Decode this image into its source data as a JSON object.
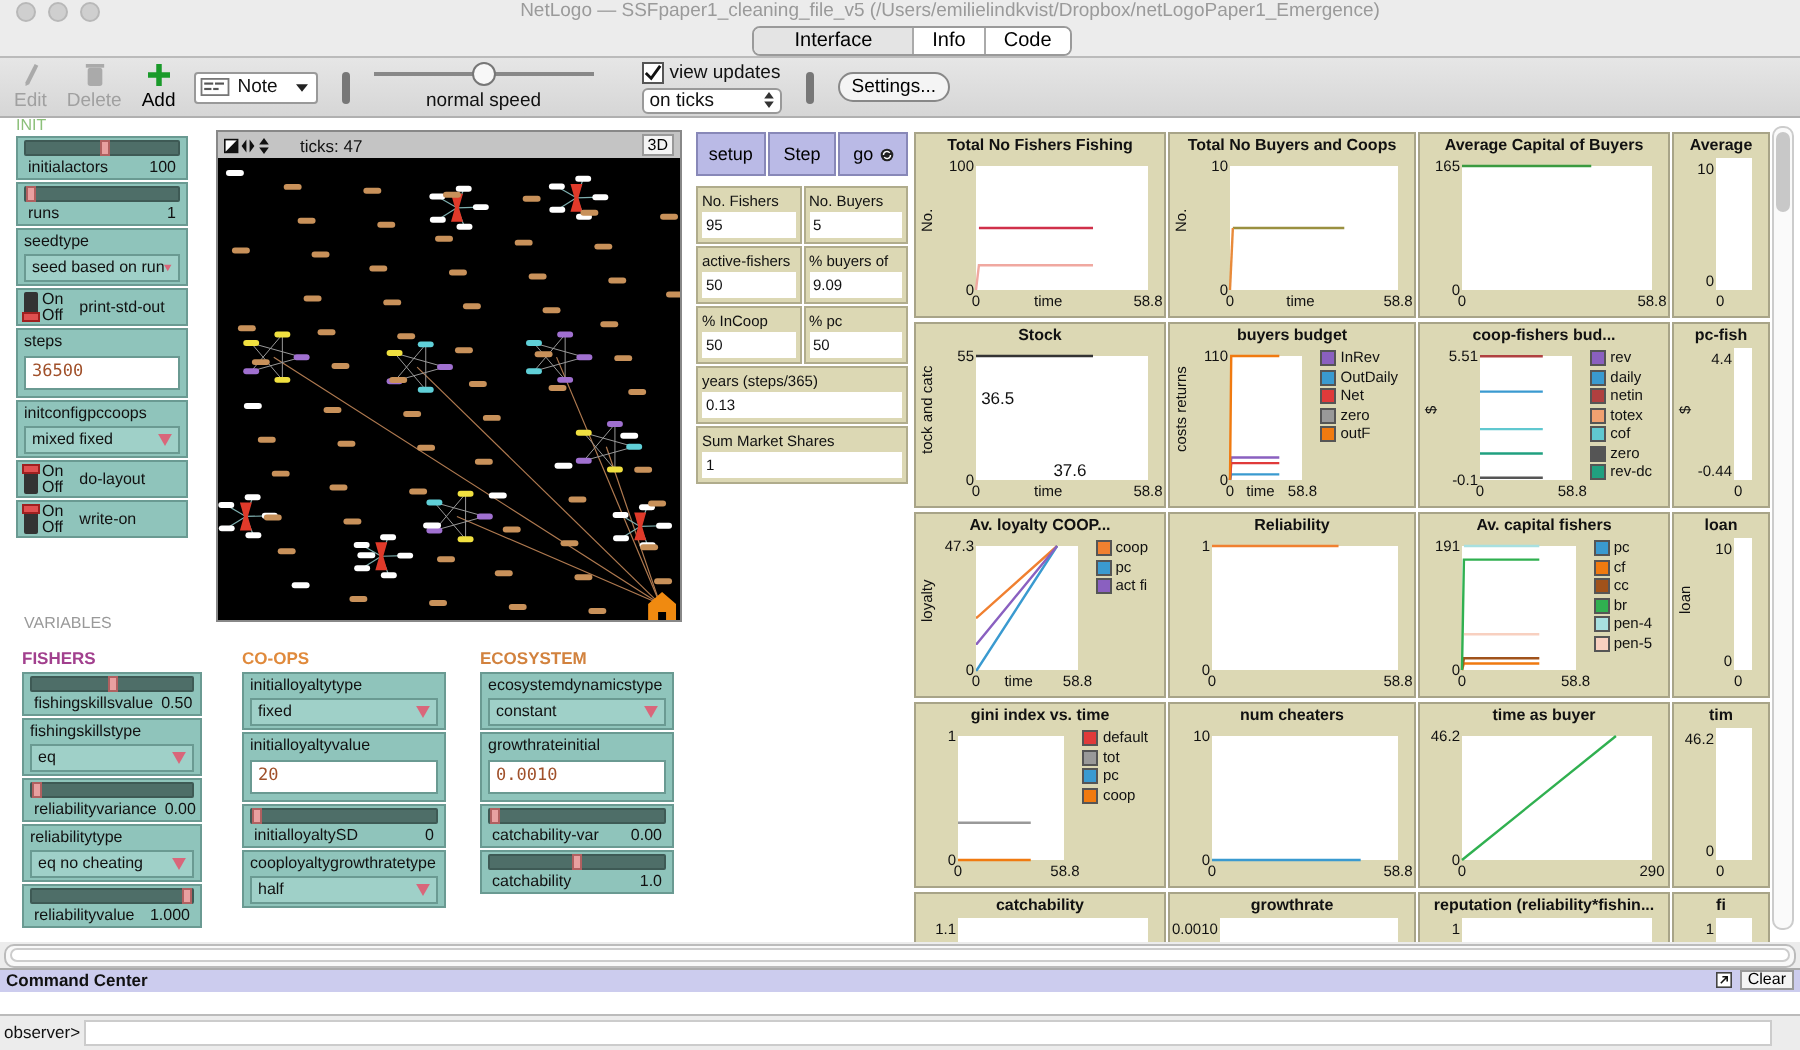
{
  "window": {
    "title": "NetLogo — SSFpaper1_cleaning_file_v5 (/Users/emilielindkvist/Dropbox/netLogoPaper1_Emergence)"
  },
  "tabs": [
    {
      "label": "Interface",
      "selected": true
    },
    {
      "label": "Info",
      "selected": false
    },
    {
      "label": "Code",
      "selected": false
    }
  ],
  "toolbar": {
    "tools": [
      {
        "label": "Edit",
        "kind": "edit",
        "disabled": true
      },
      {
        "label": "Delete",
        "kind": "delete",
        "disabled": true
      },
      {
        "label": "Add",
        "kind": "add",
        "disabled": false
      }
    ],
    "widget_type": "Note",
    "speed": {
      "level": 0.5,
      "label": "normal speed"
    },
    "view_updates": {
      "label": "view updates",
      "checked": true
    },
    "update_mode": "on ticks",
    "settings": "Settings..."
  },
  "init": {
    "label": "INIT",
    "widgets": [
      {
        "kind": "slider",
        "name": "initialactors",
        "value": "100",
        "level": 0.52
      },
      {
        "kind": "slider",
        "name": "runs",
        "value": "1",
        "level": 0
      },
      {
        "kind": "chooser",
        "name": "seedtype",
        "value": "seed based on run"
      },
      {
        "kind": "switch",
        "name": "print-std-out",
        "on": false,
        "on_label": "On",
        "off_label": "Off"
      },
      {
        "kind": "input",
        "name": "steps",
        "value": "36500"
      },
      {
        "kind": "chooser",
        "name": "initconfigpccoops",
        "value": "mixed fixed"
      },
      {
        "kind": "switch",
        "name": "do-layout",
        "on": true,
        "on_label": "On",
        "off_label": "Off"
      },
      {
        "kind": "switch",
        "name": "write-on",
        "on": true,
        "on_label": "On",
        "off_label": "Off"
      }
    ]
  },
  "view": {
    "ticks": "ticks: 47",
    "button_3d": "3D"
  },
  "buttons": [
    {
      "label": "setup",
      "forever": false
    },
    {
      "label": "Step",
      "forever": false
    },
    {
      "label": "go",
      "forever": true
    }
  ],
  "monitors": [
    {
      "name": "No. Fishers",
      "value": "95",
      "kind": "half"
    },
    {
      "name": "No. Buyers",
      "value": "5",
      "kind": "half"
    },
    {
      "name": "active-fishers",
      "value": "50",
      "kind": "half"
    },
    {
      "name": "% buyers of",
      "value": "9.09",
      "kind": "half"
    },
    {
      "name": "% InCoop",
      "value": "50",
      "kind": "half"
    },
    {
      "name": "% pc",
      "value": "50",
      "kind": "half"
    },
    {
      "name": "years (steps/365)",
      "value": "0.13",
      "kind": "full"
    },
    {
      "name": "Sum Market Shares",
      "value": "1",
      "kind": "full"
    }
  ],
  "variables": {
    "label": "VARIABLES",
    "sections": [
      {
        "title": "FISHERS",
        "color": "#a2408e",
        "widgets": [
          {
            "kind": "slider",
            "name": "fishingskillsvalue",
            "value": "0.50",
            "level": 0.5
          },
          {
            "kind": "chooser",
            "name": "fishingskillstype",
            "value": "eq"
          },
          {
            "kind": "slider",
            "name": "reliabilityvariance",
            "value": "0.00",
            "level": 0
          },
          {
            "kind": "chooser",
            "name": "reliabilitytype",
            "value": "eq no cheating"
          },
          {
            "kind": "slider",
            "name": "reliabilityvalue",
            "value": "1.000",
            "level": 1
          }
        ]
      },
      {
        "title": "CO-OPS",
        "color": "#e08a3c",
        "widgets": [
          {
            "kind": "chooser",
            "name": "initialloyaltytype",
            "value": "fixed"
          },
          {
            "kind": "input",
            "name": "initialloyaltyvalue",
            "value": "20"
          },
          {
            "kind": "slider",
            "name": "initialloyaltySD",
            "value": "0",
            "level": 0
          },
          {
            "kind": "chooser",
            "name": "cooployaltygrowthratetype",
            "value": "half"
          }
        ]
      },
      {
        "title": "ECOSYSTEM",
        "color": "#d2823e",
        "widgets": [
          {
            "kind": "chooser",
            "name": "ecosystemdynamicstype",
            "value": "constant"
          },
          {
            "kind": "input",
            "name": "growthrateinitial",
            "value": "0.0010"
          },
          {
            "kind": "slider",
            "name": "catchability-var",
            "value": "0.00",
            "level": 0
          },
          {
            "kind": "slider",
            "name": "catchability",
            "value": "1.0",
            "level": 0.5
          }
        ]
      }
    ]
  },
  "plots": [
    {
      "kind": "chart",
      "chart_data": {
        "type": "line",
        "title": "Total No Fishers Fishing",
        "xlabel": "time",
        "ylabel": "No.",
        "x": [
          0,
          1,
          40
        ],
        "xlim": [
          0,
          58.8
        ],
        "ylim": [
          0,
          100
        ],
        "xticks": [
          0,
          58.8
        ],
        "yticks": [
          0,
          100
        ],
        "series": [
          {
            "color": "#d0304a",
            "values": [
              null,
              50,
              50
            ]
          },
          {
            "color": "#f0a8a0",
            "values": [
              0,
              20,
              20
            ]
          }
        ]
      }
    },
    {
      "kind": "chart",
      "chart_data": {
        "type": "line",
        "title": "Total No Buyers and Coops",
        "xlabel": "time",
        "ylabel": "No.",
        "x": [
          0,
          1,
          40
        ],
        "xlim": [
          0,
          58.8
        ],
        "ylim": [
          0,
          10
        ],
        "xticks": [
          0,
          58.8
        ],
        "yticks": [
          0,
          10
        ],
        "series": [
          {
            "color": "#9a9040",
            "values": [
              null,
              5,
              5
            ]
          },
          {
            "color": "#e88a3a",
            "values": [
              0,
              5,
              null
            ]
          }
        ]
      }
    },
    {
      "kind": "chart",
      "chart_data": {
        "type": "line",
        "title": "Average Capital of Buyers",
        "x": [
          0,
          40
        ],
        "xlim": [
          0,
          58.8
        ],
        "ylim": [
          0,
          165
        ],
        "xticks": [
          0,
          58.8
        ],
        "yticks": [
          0,
          165
        ],
        "series": [
          {
            "color": "#3a9a40",
            "values": [
              165,
              165
            ]
          }
        ]
      }
    },
    {
      "kind": "partial",
      "title": "Average",
      "y_labels": [
        "10",
        "0"
      ],
      "x_labels": [
        "0"
      ]
    },
    {
      "kind": "chart",
      "chart_data": {
        "type": "line",
        "title": "Stock",
        "xlabel": "time",
        "ylabel": "tock and catc",
        "x": [
          0,
          40
        ],
        "xlim": [
          0,
          58.8
        ],
        "ylim": [
          0,
          55
        ],
        "xticks": [
          0,
          58.8
        ],
        "yticks": [
          0,
          55
        ],
        "series": [
          {
            "color": "#333333",
            "values": [
              55,
              55
            ]
          }
        ],
        "annotations": [
          {
            "text": "36.5"
          },
          {
            "text": "37.6"
          }
        ]
      }
    },
    {
      "kind": "chart",
      "chart_data": {
        "type": "line",
        "title": "buyers budget",
        "xlabel": "time",
        "ylabel": "costs returns",
        "legend": "right",
        "x": [
          0,
          1,
          40
        ],
        "xlim": [
          0,
          58.8
        ],
        "ylim": [
          0,
          110
        ],
        "xticks": [
          0,
          58.8
        ],
        "yticks": [
          0,
          110
        ],
        "series": [
          {
            "name": "InRev",
            "color": "#8a60c0",
            "values": [
              0,
              20,
              20
            ]
          },
          {
            "name": "OutDaily",
            "color": "#3a9ad0",
            "values": [
              0,
              5,
              5
            ]
          },
          {
            "name": "Net",
            "color": "#e03a3a",
            "values": [
              0,
              15,
              15
            ]
          },
          {
            "name": "zero",
            "color": "#999999",
            "values": [
              null,
              null,
              null
            ]
          },
          {
            "name": "outF",
            "color": "#f07a10",
            "values": [
              0,
              110,
              110
            ]
          }
        ]
      }
    },
    {
      "kind": "chart",
      "chart_data": {
        "type": "line",
        "title": "coop-fishers bud...",
        "ylabel": "$",
        "legend": "right",
        "x": [
          0,
          40
        ],
        "xlim": [
          0,
          58.8
        ],
        "ylim": [
          -0.1,
          5.51
        ],
        "xticks": [
          0,
          58.8
        ],
        "yticks": [
          -0.1,
          5.51
        ],
        "series": [
          {
            "name": "rev",
            "color": "#8a60c0",
            "values": [
              null,
              null
            ]
          },
          {
            "name": "daily",
            "color": "#3a9ad0",
            "values": [
              3.9,
              3.9
            ]
          },
          {
            "name": "netin",
            "color": "#b04040",
            "values": [
              5.5,
              5.5
            ]
          },
          {
            "name": "totex",
            "color": "#f0a070",
            "values": [
              null,
              null
            ]
          },
          {
            "name": "cof",
            "color": "#60c8d0",
            "values": [
              2.2,
              2.2
            ]
          },
          {
            "name": "zero",
            "color": "#555555",
            "values": [
              0,
              0
            ]
          },
          {
            "name": "rev-dc",
            "color": "#20a080",
            "values": [
              1.1,
              1.1
            ]
          }
        ]
      }
    },
    {
      "kind": "partial",
      "title": "pc-fish",
      "ylabel": "$",
      "y_labels": [
        "4.4",
        "-0.44"
      ],
      "x_labels": [
        "0"
      ]
    },
    {
      "kind": "chart",
      "chart_data": {
        "type": "line",
        "title": "Av. loyalty COOP...",
        "xlabel": "time",
        "ylabel": "loyalty",
        "legend": "right",
        "x": [
          0,
          0.5,
          47
        ],
        "xlim": [
          0,
          58.8
        ],
        "ylim": [
          0,
          47.3
        ],
        "xticks": [
          0,
          58.8
        ],
        "yticks": [
          0,
          47.3
        ],
        "series": [
          {
            "name": "coop",
            "color": "#f08030",
            "values": [
              20,
              20,
              47.3
            ]
          },
          {
            "name": "pc",
            "color": "#3a9ad0",
            "values": [
              0,
              0,
              47.3
            ]
          },
          {
            "name": "act fi",
            "color": "#8a60c0",
            "values": [
              10,
              10,
              47.3
            ]
          }
        ]
      }
    },
    {
      "kind": "chart",
      "chart_data": {
        "type": "line",
        "title": "Reliability",
        "x": [
          0,
          40
        ],
        "xlim": [
          0,
          58.8
        ],
        "ylim": [
          0,
          1
        ],
        "xticks": [
          0,
          58.8
        ],
        "yticks": [
          0,
          1
        ],
        "series": [
          {
            "color": "#f08030",
            "values": [
              1,
              1
            ]
          }
        ]
      }
    },
    {
      "kind": "chart",
      "chart_data": {
        "type": "line",
        "title": "Av. capital fishers",
        "legend": "right",
        "x": [
          0,
          1,
          40
        ],
        "xlim": [
          0,
          58.8
        ],
        "ylim": [
          0,
          191
        ],
        "xticks": [
          0,
          58.8
        ],
        "yticks": [
          0,
          191
        ],
        "series": [
          {
            "name": "pc",
            "color": "#3a9ad0",
            "values": [
              null,
              null,
              null
            ]
          },
          {
            "name": "cf",
            "color": "#f07a10",
            "values": [
              0,
              10,
              10
            ]
          },
          {
            "name": "cc",
            "color": "#a0521a",
            "values": [
              0,
              18,
              18
            ]
          },
          {
            "name": "br",
            "color": "#30b050",
            "values": [
              0,
              170,
              170
            ]
          },
          {
            "name": "pen-4",
            "color": "#a8e0e0",
            "values": [
              null,
              191,
              191
            ]
          },
          {
            "name": "pen-5",
            "color": "#f8d0c0",
            "values": [
              null,
              55,
              55
            ]
          }
        ]
      }
    },
    {
      "kind": "partial",
      "title": "loan",
      "ylabel": "loan",
      "y_labels": [
        "10",
        "0"
      ],
      "x_labels": [
        "0"
      ]
    },
    {
      "kind": "chart",
      "chart_data": {
        "type": "line",
        "title": "gini index vs. time",
        "legend": "right",
        "x": [
          0,
          40
        ],
        "xlim": [
          0,
          58.8
        ],
        "ylim": [
          0,
          1
        ],
        "xticks": [
          0,
          58.8
        ],
        "yticks": [
          0,
          1
        ],
        "series": [
          {
            "name": "default",
            "color": "#e03a3a",
            "values": [
              null,
              null
            ]
          },
          {
            "name": "tot",
            "color": "#999999",
            "values": [
              0.3,
              0.3
            ]
          },
          {
            "name": "pc",
            "color": "#3a9ad0",
            "values": [
              null,
              null
            ]
          },
          {
            "name": "coop",
            "color": "#f07a10",
            "values": [
              0,
              0
            ]
          }
        ]
      }
    },
    {
      "kind": "chart",
      "chart_data": {
        "type": "line",
        "title": "num cheaters",
        "x": [
          0,
          47
        ],
        "xlim": [
          0,
          58.8
        ],
        "ylim": [
          0,
          10
        ],
        "xticks": [
          0,
          58.8
        ],
        "yticks": [
          0,
          10
        ],
        "series": [
          {
            "color": "#3a9ad0",
            "values": [
              0,
              0
            ]
          }
        ]
      }
    },
    {
      "kind": "chart",
      "chart_data": {
        "type": "line",
        "title": "time as buyer",
        "x": [
          0,
          235
        ],
        "xlim": [
          0,
          290
        ],
        "ylim": [
          0,
          46.2
        ],
        "xticks": [
          0,
          290
        ],
        "yticks": [
          0,
          46.2
        ],
        "series": [
          {
            "color": "#30b050",
            "values": [
              0,
              46.2
            ]
          }
        ]
      }
    },
    {
      "kind": "partial",
      "title": "tim",
      "y_labels": [
        "46.2",
        "0"
      ],
      "x_labels": [
        "0"
      ]
    },
    {
      "kind": "partial",
      "title": "catchability",
      "y_labels": [
        "1.1"
      ]
    },
    {
      "kind": "partial",
      "title": "growthrate",
      "y_labels": [
        "0.0010"
      ]
    },
    {
      "kind": "partial",
      "title": "reputation (reliability*fishin...",
      "y_labels": [
        "1"
      ]
    },
    {
      "kind": "partial",
      "title": "fi",
      "y_labels": [
        "1"
      ]
    }
  ],
  "command_center": {
    "title": "Command Center",
    "clear": "Clear",
    "prompt": "observer>"
  }
}
